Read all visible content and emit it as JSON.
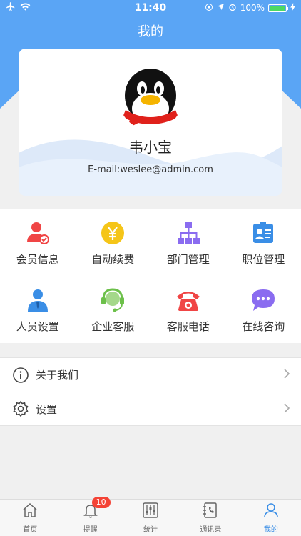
{
  "status_bar": {
    "time": "11:40",
    "battery_text": "100%",
    "battery_level": 1.0,
    "icons_left": [
      "airplane-icon",
      "wifi-icon"
    ],
    "icons_right": [
      "lock-rotation-icon",
      "location-icon",
      "alarm-icon",
      "charging-icon"
    ]
  },
  "header": {
    "title": "我的"
  },
  "profile": {
    "name": "韦小宝",
    "email": "E-mail:weslee@admin.com",
    "avatar": "qq-penguin-avatar"
  },
  "grid": {
    "items": [
      {
        "label": "会员信息",
        "icon": "member-info-icon",
        "color": "#f04545"
      },
      {
        "label": "自动续费",
        "icon": "yuan-icon",
        "color": "#f5c518"
      },
      {
        "label": "部门管理",
        "icon": "org-chart-icon",
        "color": "#8a6cf0"
      },
      {
        "label": "职位管理",
        "icon": "id-card-icon",
        "color": "#3a8ee6"
      },
      {
        "label": "人员设置",
        "icon": "person-settings-icon",
        "color": "#3a8ee6"
      },
      {
        "label": "企业客服",
        "icon": "headset-icon",
        "color": "#6cc04a"
      },
      {
        "label": "客服电话",
        "icon": "telephone-icon",
        "color": "#f04545"
      },
      {
        "label": "在线咨询",
        "icon": "chat-bubble-icon",
        "color": "#8a6cf0"
      }
    ]
  },
  "list": {
    "items": [
      {
        "label": "关于我们",
        "icon": "info-icon"
      },
      {
        "label": "设置",
        "icon": "gear-icon"
      }
    ]
  },
  "tabbar": {
    "items": [
      {
        "label": "首页",
        "icon": "home-icon",
        "active": false
      },
      {
        "label": "提醒",
        "icon": "bell-icon",
        "active": false,
        "badge": "10"
      },
      {
        "label": "统计",
        "icon": "sliders-icon",
        "active": false
      },
      {
        "label": "通讯录",
        "icon": "contacts-book-icon",
        "active": false
      },
      {
        "label": "我的",
        "icon": "user-icon",
        "active": true
      }
    ]
  },
  "colors": {
    "brand_blue": "#5aa5f5",
    "active_tab": "#3a8ee6",
    "badge_red": "#f44336"
  }
}
